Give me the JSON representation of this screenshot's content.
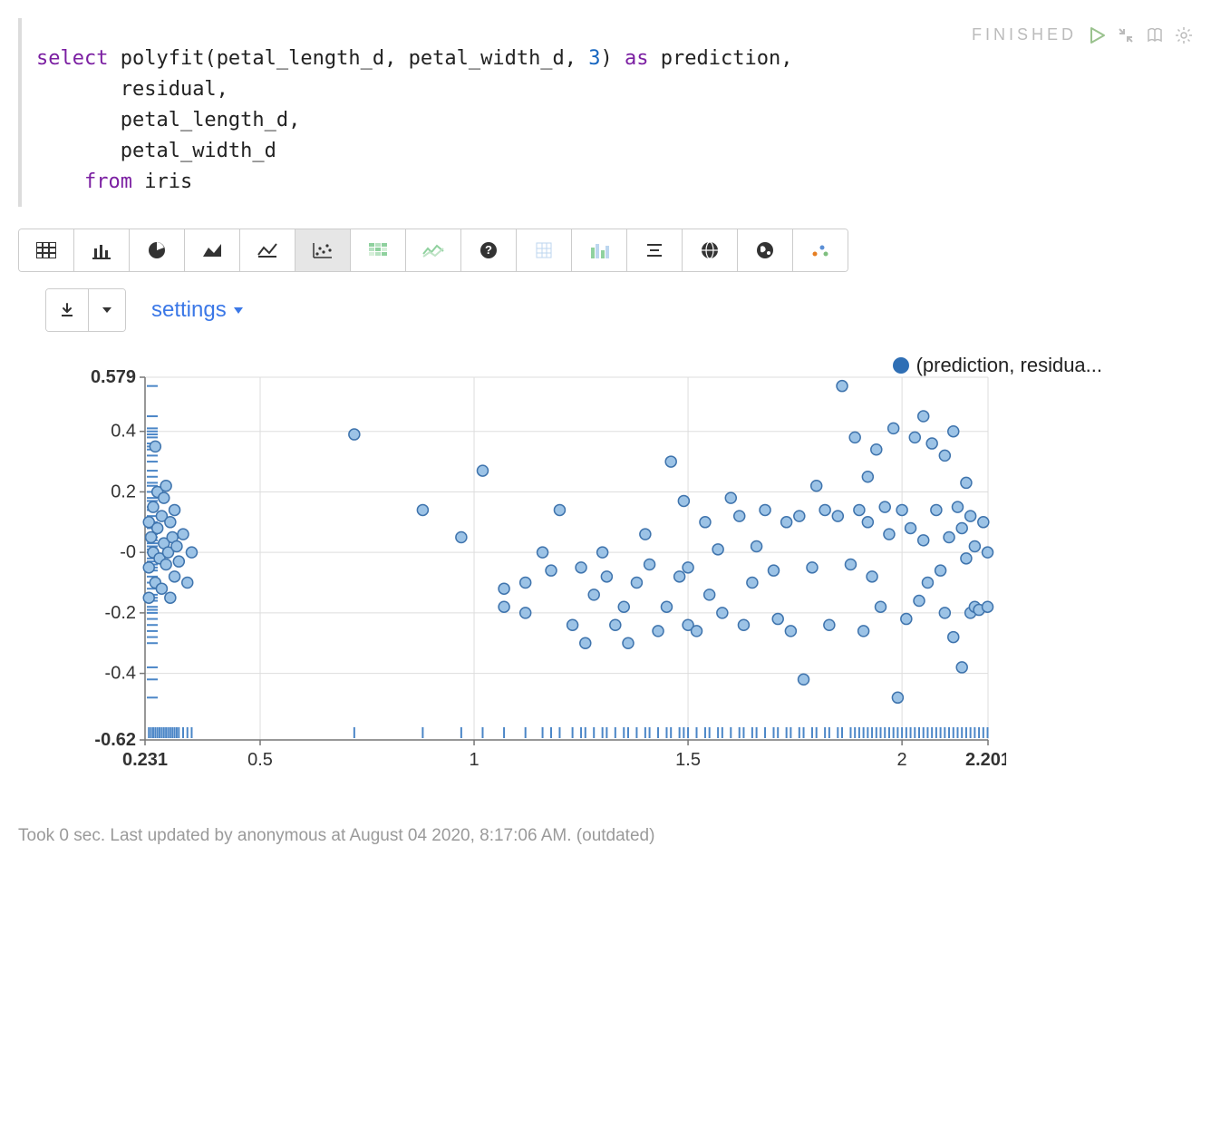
{
  "status_label": "FINISHED",
  "settings_label": "settings",
  "legend_label": "(prediction, residua...",
  "footer_text": "Took 0 sec. Last updated by anonymous at August 04 2020, 8:17:06 AM. (outdated)",
  "code": {
    "l1a": "select",
    "l1b": " polyfit(petal_length_d, petal_width_d, ",
    "l1c": "3",
    "l1d": ") ",
    "l1e": "as",
    "l1f": " prediction,",
    "l2": "residual,",
    "l3": "petal_length_d,",
    "l4": "petal_width_d",
    "l5a": "from",
    "l5b": " iris"
  },
  "chart_data": {
    "type": "scatter",
    "xlabel": "",
    "ylabel": "",
    "xlim": [
      0.231,
      2.201
    ],
    "ylim": [
      -0.62,
      0.579
    ],
    "x_ticks": [
      0.231,
      0.5,
      1,
      1.5,
      2,
      2.201
    ],
    "y_ticks": [
      -0.62,
      -0.4,
      -0.2,
      0,
      0.2,
      0.4,
      0.579
    ],
    "series": [
      {
        "name": "(prediction, residual)",
        "points": [
          [
            0.24,
            -0.15
          ],
          [
            0.24,
            0.1
          ],
          [
            0.24,
            -0.05
          ],
          [
            0.245,
            0.05
          ],
          [
            0.25,
            0.0
          ],
          [
            0.25,
            0.15
          ],
          [
            0.255,
            0.35
          ],
          [
            0.255,
            -0.1
          ],
          [
            0.26,
            0.2
          ],
          [
            0.26,
            0.08
          ],
          [
            0.265,
            -0.02
          ],
          [
            0.27,
            0.12
          ],
          [
            0.27,
            -0.12
          ],
          [
            0.275,
            0.18
          ],
          [
            0.275,
            0.03
          ],
          [
            0.28,
            -0.04
          ],
          [
            0.28,
            0.22
          ],
          [
            0.285,
            0.0
          ],
          [
            0.29,
            0.1
          ],
          [
            0.29,
            -0.15
          ],
          [
            0.295,
            0.05
          ],
          [
            0.3,
            -0.08
          ],
          [
            0.3,
            0.14
          ],
          [
            0.305,
            0.02
          ],
          [
            0.31,
            -0.03
          ],
          [
            0.32,
            0.06
          ],
          [
            0.33,
            -0.1
          ],
          [
            0.34,
            0.0
          ],
          [
            0.72,
            0.39
          ],
          [
            0.88,
            0.14
          ],
          [
            0.97,
            0.05
          ],
          [
            1.02,
            0.27
          ],
          [
            1.07,
            -0.12
          ],
          [
            1.07,
            -0.18
          ],
          [
            1.12,
            -0.1
          ],
          [
            1.12,
            -0.2
          ],
          [
            1.16,
            0.0
          ],
          [
            1.18,
            -0.06
          ],
          [
            1.2,
            0.14
          ],
          [
            1.23,
            -0.24
          ],
          [
            1.25,
            -0.05
          ],
          [
            1.26,
            -0.3
          ],
          [
            1.28,
            -0.14
          ],
          [
            1.3,
            0.0
          ],
          [
            1.31,
            -0.08
          ],
          [
            1.33,
            -0.24
          ],
          [
            1.35,
            -0.18
          ],
          [
            1.36,
            -0.3
          ],
          [
            1.38,
            -0.1
          ],
          [
            1.4,
            0.06
          ],
          [
            1.41,
            -0.04
          ],
          [
            1.43,
            -0.26
          ],
          [
            1.45,
            -0.18
          ],
          [
            1.46,
            0.3
          ],
          [
            1.48,
            -0.08
          ],
          [
            1.49,
            0.17
          ],
          [
            1.5,
            -0.05
          ],
          [
            1.5,
            -0.24
          ],
          [
            1.52,
            -0.26
          ],
          [
            1.54,
            0.1
          ],
          [
            1.55,
            -0.14
          ],
          [
            1.57,
            0.01
          ],
          [
            1.58,
            -0.2
          ],
          [
            1.6,
            0.18
          ],
          [
            1.62,
            0.12
          ],
          [
            1.63,
            -0.24
          ],
          [
            1.65,
            -0.1
          ],
          [
            1.66,
            0.02
          ],
          [
            1.68,
            0.14
          ],
          [
            1.7,
            -0.06
          ],
          [
            1.71,
            -0.22
          ],
          [
            1.73,
            0.1
          ],
          [
            1.74,
            -0.26
          ],
          [
            1.76,
            0.12
          ],
          [
            1.77,
            -0.42
          ],
          [
            1.79,
            -0.05
          ],
          [
            1.8,
            0.22
          ],
          [
            1.82,
            0.14
          ],
          [
            1.83,
            -0.24
          ],
          [
            1.85,
            0.12
          ],
          [
            1.86,
            0.55
          ],
          [
            1.88,
            -0.04
          ],
          [
            1.89,
            0.38
          ],
          [
            1.9,
            0.14
          ],
          [
            1.91,
            -0.26
          ],
          [
            1.92,
            0.1
          ],
          [
            1.92,
            0.25
          ],
          [
            1.93,
            -0.08
          ],
          [
            1.94,
            0.34
          ],
          [
            1.95,
            -0.18
          ],
          [
            1.96,
            0.15
          ],
          [
            1.97,
            0.06
          ],
          [
            1.98,
            0.41
          ],
          [
            1.99,
            -0.48
          ],
          [
            2.0,
            0.14
          ],
          [
            2.01,
            -0.22
          ],
          [
            2.02,
            0.08
          ],
          [
            2.03,
            0.38
          ],
          [
            2.04,
            -0.16
          ],
          [
            2.05,
            0.04
          ],
          [
            2.05,
            0.45
          ],
          [
            2.06,
            -0.1
          ],
          [
            2.07,
            0.36
          ],
          [
            2.08,
            0.14
          ],
          [
            2.09,
            -0.06
          ],
          [
            2.1,
            0.32
          ],
          [
            2.1,
            -0.2
          ],
          [
            2.11,
            0.05
          ],
          [
            2.12,
            0.4
          ],
          [
            2.12,
            -0.28
          ],
          [
            2.13,
            0.15
          ],
          [
            2.14,
            -0.38
          ],
          [
            2.14,
            0.08
          ],
          [
            2.15,
            -0.02
          ],
          [
            2.15,
            0.23
          ],
          [
            2.16,
            -0.2
          ],
          [
            2.16,
            0.12
          ],
          [
            2.17,
            -0.18
          ],
          [
            2.17,
            0.02
          ],
          [
            2.18,
            -0.19
          ],
          [
            2.19,
            0.1
          ],
          [
            2.2,
            -0.18
          ],
          [
            2.2,
            0.0
          ]
        ]
      }
    ]
  }
}
